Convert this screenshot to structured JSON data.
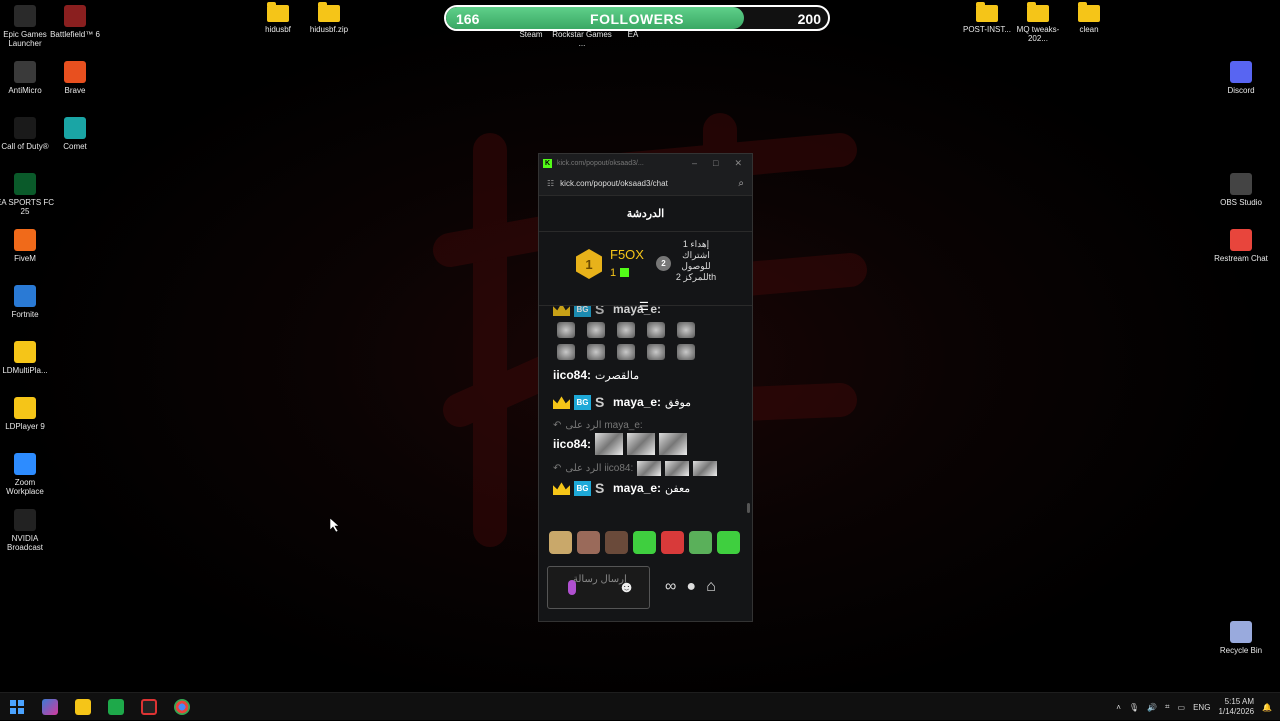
{
  "desktop": {
    "left_icons": [
      {
        "label": "Epic Games Launcher",
        "icon": "epic-games-icon"
      },
      {
        "label": "Battlefield™ 6",
        "icon": "battlefield-icon"
      },
      {
        "label": "AntiMicro",
        "icon": "antimicro-icon"
      },
      {
        "label": "Brave",
        "icon": "brave-icon"
      },
      {
        "label": "Call of Duty®",
        "icon": "call-of-duty-icon"
      },
      {
        "label": "Comet",
        "icon": "comet-icon"
      },
      {
        "label": "EA SPORTS FC 25",
        "icon": "ea-fc-icon"
      },
      {
        "label": "FiveM",
        "icon": "fivem-icon"
      },
      {
        "label": "Fortnite",
        "icon": "fortnite-icon"
      },
      {
        "label": "LDMultiPla...",
        "icon": "ldmultiplayer-icon"
      },
      {
        "label": "LDPlayer 9",
        "icon": "ldplayer-icon"
      },
      {
        "label": "Zoom Workplace",
        "icon": "zoom-icon"
      },
      {
        "label": "NVIDIA Broadcast",
        "icon": "nvidia-broadcast-icon"
      }
    ],
    "top_icons": [
      {
        "label": "hidusbf",
        "icon": "folder-icon"
      },
      {
        "label": "hidusbf.zip",
        "icon": "zip-folder-icon"
      },
      {
        "label": "Steam",
        "icon": "steam-icon"
      },
      {
        "label": "Rockstar Games ...",
        "icon": "rockstar-icon"
      },
      {
        "label": "EA",
        "icon": "ea-icon"
      },
      {
        "label": "POST-INST...",
        "icon": "folder-icon"
      },
      {
        "label": "MQ tweaks-202...",
        "icon": "folder-icon"
      },
      {
        "label": "clean",
        "icon": "folder-icon"
      }
    ],
    "right_icons": [
      {
        "label": "Discord",
        "icon": "discord-icon"
      },
      {
        "label": "OBS Studio",
        "icon": "obs-icon"
      },
      {
        "label": "Restream Chat",
        "icon": "restream-icon"
      },
      {
        "label": "Recycle Bin",
        "icon": "recycle-bin-icon"
      }
    ]
  },
  "followers": {
    "min": "166",
    "title": "FOLLOWERS",
    "max": "200",
    "progress": 0.78
  },
  "popup": {
    "window_title": "kick.com/popout/oksaad3/...",
    "url": "kick.com/popout/oksaad3/chat",
    "chat_header": "الدردشة",
    "leader": {
      "rank": "1",
      "name": "F5OX",
      "count": "1",
      "rank2": "2",
      "rank2_text": "إهداء 1 اشتراك للوصول للمركز 2th"
    },
    "messages": {
      "m0_user": "maya_e:",
      "m1": {
        "user": "iico84:",
        "text": "مالقصرت"
      },
      "m2": {
        "user": "maya_e:",
        "text": "موفق",
        "badge": "BG",
        "s": "S"
      },
      "m3_reply": "الرد على maya_e:",
      "m3_user": "iico84:",
      "m4_reply": "الرد على iico84:",
      "m4": {
        "user": "maya_e:",
        "text": "معفن",
        "badge": "BG",
        "s": "S"
      }
    },
    "input_placeholder": "إرسال رسالة",
    "tools": {
      "infinity": "∞",
      "smile": "☻",
      "store": "⌂"
    }
  },
  "taskbar": {
    "lang": "ENG",
    "time": "5:15 AM",
    "date": "1/14/2026"
  }
}
